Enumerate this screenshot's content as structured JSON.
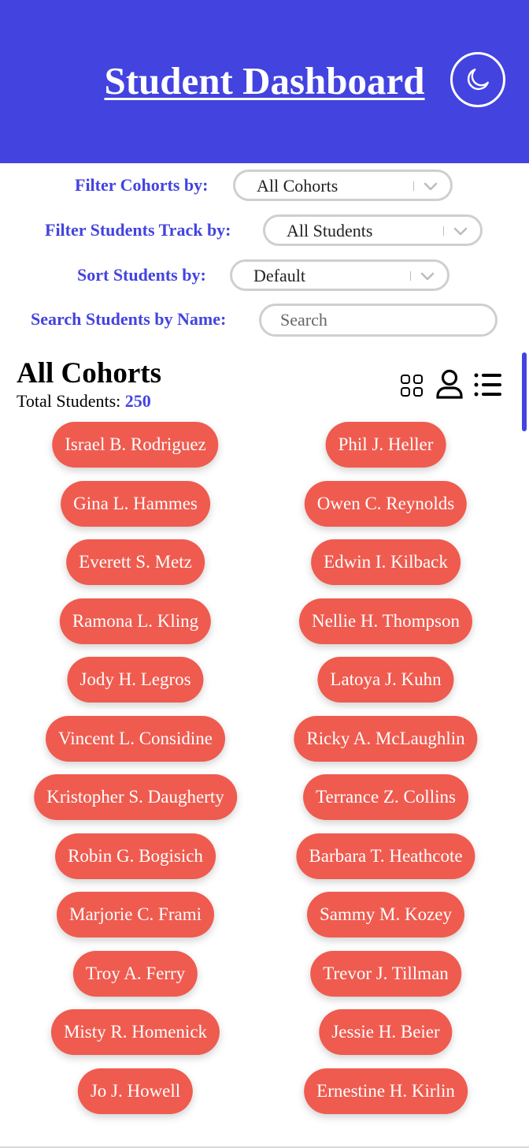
{
  "header": {
    "title": "Student Dashboard",
    "theme_toggle_icon": "moon-icon",
    "background_color": "#4343e0"
  },
  "filters": {
    "cohorts": {
      "label": "Filter Cohorts by:",
      "value": "All Cohorts"
    },
    "track": {
      "label": "Filter Students Track by:",
      "value": "All Students"
    },
    "sort": {
      "label": "Sort Students by:",
      "value": "Default"
    },
    "search": {
      "label": "Search Students by Name:",
      "placeholder": "Search",
      "value": ""
    }
  },
  "section": {
    "title": "All Cohorts",
    "total_label": "Total Students:",
    "total_count": "250"
  },
  "view_icons": [
    "grid-view-icon",
    "user-view-icon",
    "list-view-icon"
  ],
  "colors": {
    "accent": "#4343e0",
    "student_pill": "#ef5b4f"
  },
  "students": [
    "Israel B. Rodriguez",
    "Phil J. Heller",
    "Gina L. Hammes",
    "Owen C. Reynolds",
    "Everett S. Metz",
    "Edwin I. Kilback",
    "Ramona L. Kling",
    "Nellie H. Thompson",
    "Jody H. Legros",
    "Latoya J. Kuhn",
    "Vincent L. Considine",
    "Ricky A. McLaughlin",
    "Kristopher S. Daugherty",
    "Terrance Z. Collins",
    "Robin G. Bogisich",
    "Barbara T. Heathcote",
    "Marjorie C. Frami",
    "Sammy M. Kozey",
    "Troy A. Ferry",
    "Trevor J. Tillman",
    "Misty R. Homenick",
    "Jessie H. Beier",
    "Jo J. Howell",
    "Ernestine H. Kirlin"
  ]
}
